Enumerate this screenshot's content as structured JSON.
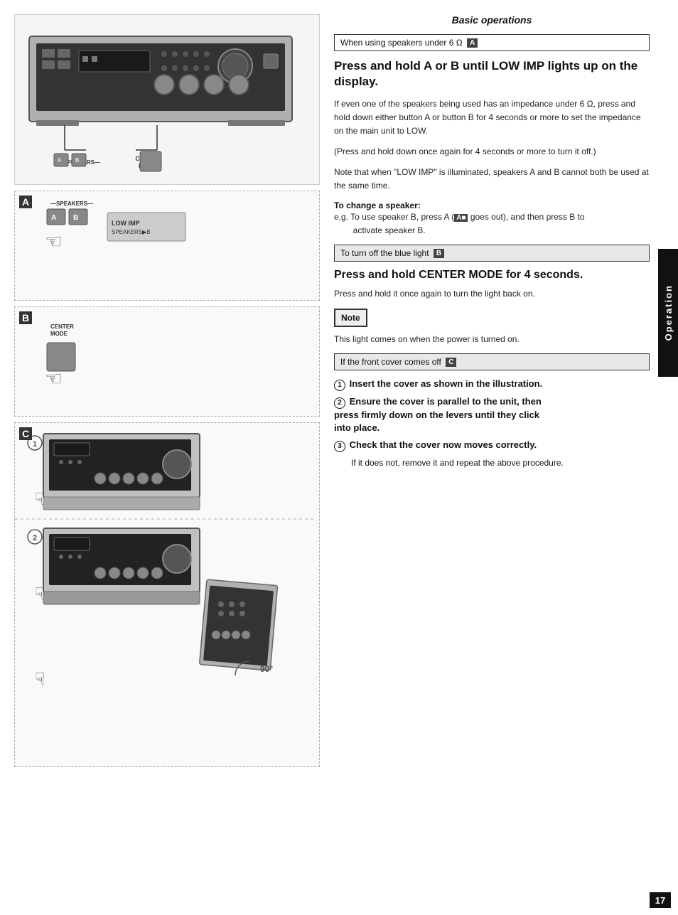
{
  "page": {
    "title": "Basic operations",
    "page_number": "17",
    "sidebar_label": "Operation"
  },
  "section_speakers": {
    "box_header": "When using speakers under 6 Ω  A",
    "main_heading": "Press and hold A or B until LOW IMP lights up on the display.",
    "para1": "If even one of the speakers being used has an impedance under 6 Ω, press and hold down either button A or button B for 4 seconds or more to set the impedance on the main unit to LOW.",
    "para2": "(Press and hold down once again for 4 seconds or more to turn it off.)",
    "para3": "Note that when \"LOW IMP\" is illuminated, speakers A and B cannot both be used at the same time.",
    "change_speaker_label": "To change a speaker:",
    "change_speaker_text": "e.g. To use speaker B, press A (  goes out), and then press B to activate speaker B."
  },
  "section_blue_light": {
    "box_header": "To turn off the blue light  B",
    "main_heading": "Press and hold CENTER MODE for 4 seconds.",
    "para1": "Press and hold it once again to turn the light back on.",
    "note_label": "Note",
    "note_text": "This light comes on when the power is turned on."
  },
  "section_front_cover": {
    "box_header": "If the front cover comes off  C",
    "step1": "① Insert the cover as shown in the illustration.",
    "step2": "② Ensure the cover is parallel to the unit, then press firmly down on the levers until they click into place.",
    "step3": "③ Check that the cover now moves correctly.",
    "step3_sub": "If it does not, remove it and repeat the above procedure."
  },
  "diagram_labels": {
    "label_a": "A",
    "label_b": "B",
    "label_c": "C",
    "speakers_label": "—SPEAKERS—",
    "center_mode": "CENTER\nMODE",
    "low_imp": "LOW IMP\nSPEAKERS▶B",
    "circle_1": "①",
    "circle_2": "②",
    "degrees_90": "90°"
  }
}
